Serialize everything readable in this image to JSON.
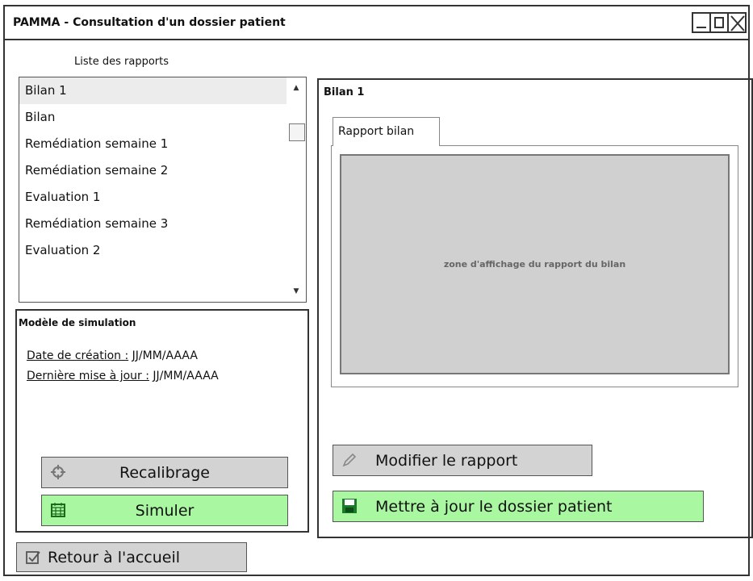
{
  "window": {
    "title": "PAMMA - Consultation d'un dossier patient"
  },
  "reports": {
    "label": "Liste des rapports",
    "items": [
      "Bilan 1",
      "Bilan",
      "Remédiation semaine 1",
      "Remédiation semaine 2",
      "Evaluation 1",
      "Remédiation semaine 3",
      "Evaluation 2"
    ],
    "selected": "Bilan 1"
  },
  "model": {
    "title": "Modèle de simulation",
    "created_label": "Date de création :",
    "created_value": "JJ/MM/AAAA",
    "updated_label": "Dernière mise à jour :",
    "updated_value": "JJ/MM/AAAA",
    "recalibrate_label": "Recalibrage",
    "simulate_label": "Simuler"
  },
  "detail": {
    "title": "Bilan 1",
    "tab_label": "Rapport bilan",
    "zone_text": "zone d'affichage du rapport du bilan",
    "edit_label": "Modifier le rapport",
    "update_label": "Mettre à jour le dossier patient"
  },
  "footer": {
    "home_label": "Retour à l'accueil"
  },
  "colors": {
    "green_button": "#a9f7a0",
    "grey_button": "#d3d3d3",
    "report_zone": "#d0d0d0"
  }
}
